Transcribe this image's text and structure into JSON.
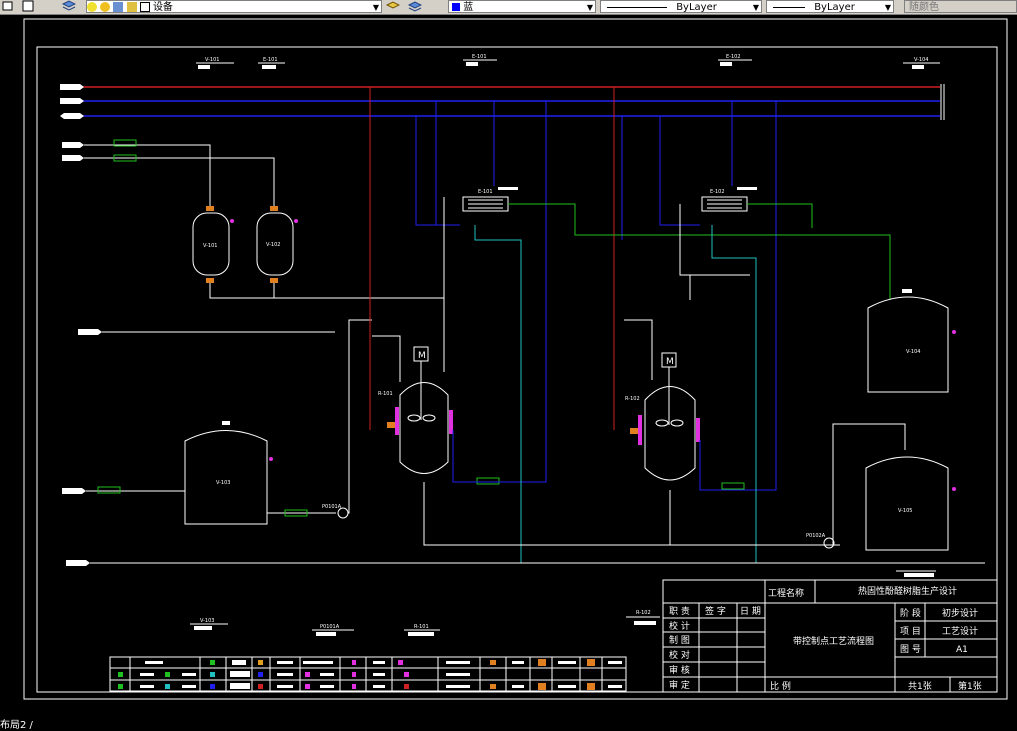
{
  "toolbar": {
    "layer_name": "设备",
    "color_name": "蓝",
    "linetype": "ByLayer",
    "lineweight": "ByLayer",
    "plotstyle": "随颜色"
  },
  "drawing": {
    "equipment": {
      "v101": "V-101",
      "v102": "V-102",
      "v103": "V-103",
      "v104": "V-104",
      "v105": "V-105",
      "r101": "R-101",
      "r102": "R-102",
      "e101": "E-101",
      "e102": "E-102",
      "p0101a": "P0101A",
      "p0102a": "P0102A"
    },
    "top_tags": [
      "V-101",
      "E-101",
      "E-101",
      "E-102",
      "V-104"
    ],
    "bottom_tags": [
      "V-103",
      "P0101A",
      "R-101",
      "R-102"
    ],
    "title_block": {
      "project_label": "工程名称",
      "project_name": "热固性酚醛树脂生产设计",
      "sign_rows": [
        "职 责",
        "校 计",
        "制 图",
        "校 对",
        "审 核",
        "审 定"
      ],
      "sign_headers": [
        "签 字",
        "日 期"
      ],
      "drawing_title": "带控制点工艺流程图",
      "stage_label": "阶 段",
      "stage_value": "初步设计",
      "item_label": "项 目",
      "item_value": "工艺设计",
      "drawing_no_label": "图 号",
      "drawing_no_value": "A1",
      "scale_label": "比 例",
      "sheets_total": "共1张",
      "sheet_no": "第1张"
    }
  },
  "status_text": "布局2 /"
}
